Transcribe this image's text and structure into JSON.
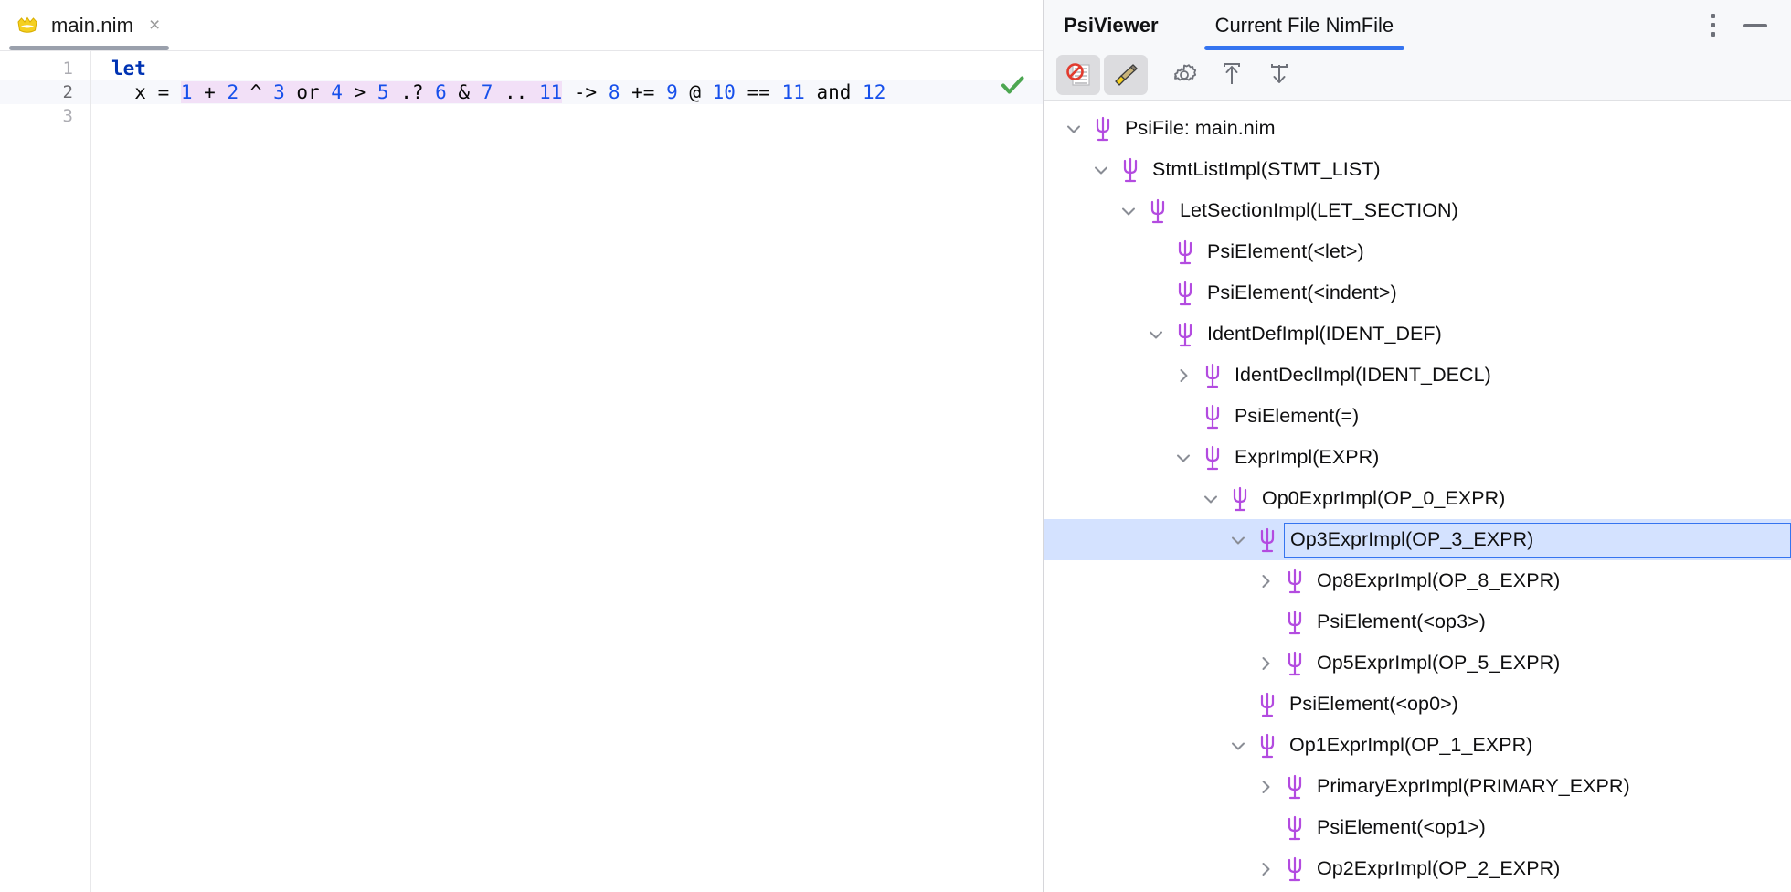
{
  "editor": {
    "tab": {
      "label": "main.nim",
      "icon": "nim-crown-icon",
      "close_label": "×"
    },
    "status_icon": "green-checkmark-icon",
    "lines": [
      {
        "number": "1",
        "current": false,
        "tokens": [
          {
            "text": "let",
            "kind": "kw",
            "highlight": false
          }
        ]
      },
      {
        "number": "2",
        "current": true,
        "tokens": [
          {
            "text": "  x ",
            "kind": "op",
            "highlight": false
          },
          {
            "text": "= ",
            "kind": "op",
            "highlight": false
          },
          {
            "text": "1",
            "kind": "num",
            "highlight": true
          },
          {
            "text": " + ",
            "kind": "op",
            "highlight": true
          },
          {
            "text": "2",
            "kind": "num",
            "highlight": true
          },
          {
            "text": " ^ ",
            "kind": "op",
            "highlight": true
          },
          {
            "text": "3",
            "kind": "num",
            "highlight": true
          },
          {
            "text": " or ",
            "kind": "op",
            "highlight": true
          },
          {
            "text": "4",
            "kind": "num",
            "highlight": true
          },
          {
            "text": " > ",
            "kind": "op",
            "highlight": true
          },
          {
            "text": "5",
            "kind": "num",
            "highlight": true
          },
          {
            "text": " .? ",
            "kind": "op",
            "highlight": true
          },
          {
            "text": "6",
            "kind": "num",
            "highlight": true
          },
          {
            "text": " & ",
            "kind": "op",
            "highlight": true
          },
          {
            "text": "7",
            "kind": "num",
            "highlight": true
          },
          {
            "text": " .. ",
            "kind": "op",
            "highlight": true
          },
          {
            "text": "11",
            "kind": "num",
            "highlight": true
          },
          {
            "text": " -> ",
            "kind": "op",
            "highlight": false
          },
          {
            "text": "8",
            "kind": "num",
            "highlight": false
          },
          {
            "text": " += ",
            "kind": "op",
            "highlight": false
          },
          {
            "text": "9",
            "kind": "num",
            "highlight": false
          },
          {
            "text": " @ ",
            "kind": "op",
            "highlight": false
          },
          {
            "text": "10",
            "kind": "num",
            "highlight": false
          },
          {
            "text": " == ",
            "kind": "op",
            "highlight": false
          },
          {
            "text": "11",
            "kind": "num",
            "highlight": false
          },
          {
            "text": " and ",
            "kind": "op",
            "highlight": false
          },
          {
            "text": "12",
            "kind": "num",
            "highlight": false
          }
        ]
      },
      {
        "number": "3",
        "current": false,
        "tokens": []
      }
    ]
  },
  "psi_panel": {
    "title": "PsiViewer",
    "tab_label": "Current File NimFile",
    "tab_accent": "#3574f0",
    "options_icon": "kebab-menu-icon",
    "minimize_icon": "minimize-icon",
    "toolbar": [
      {
        "name": "block-list-icon",
        "label": "",
        "active": true
      },
      {
        "name": "highlighter-brush-icon",
        "label": "",
        "active": true
      },
      {
        "name": "gear-icon",
        "label": "",
        "active": false
      },
      {
        "name": "export-up-icon",
        "label": "",
        "active": false
      },
      {
        "name": "import-down-icon",
        "label": "",
        "active": false
      }
    ],
    "tree": [
      {
        "label": "PsiFile: main.nim",
        "depth": 0,
        "twisty": "down",
        "selected": false
      },
      {
        "label": "StmtListImpl(STMT_LIST)",
        "depth": 1,
        "twisty": "down",
        "selected": false
      },
      {
        "label": "LetSectionImpl(LET_SECTION)",
        "depth": 2,
        "twisty": "down",
        "selected": false
      },
      {
        "label": "PsiElement(<let>)",
        "depth": 3,
        "twisty": "none",
        "selected": false
      },
      {
        "label": "PsiElement(<indent>)",
        "depth": 3,
        "twisty": "none",
        "selected": false
      },
      {
        "label": "IdentDefImpl(IDENT_DEF)",
        "depth": 3,
        "twisty": "down",
        "selected": false
      },
      {
        "label": "IdentDeclImpl(IDENT_DECL)",
        "depth": 4,
        "twisty": "right",
        "selected": false
      },
      {
        "label": "PsiElement(=)",
        "depth": 4,
        "twisty": "none",
        "selected": false
      },
      {
        "label": "ExprImpl(EXPR)",
        "depth": 4,
        "twisty": "down",
        "selected": false
      },
      {
        "label": "Op0ExprImpl(OP_0_EXPR)",
        "depth": 5,
        "twisty": "down",
        "selected": false
      },
      {
        "label": "Op3ExprImpl(OP_3_EXPR)",
        "depth": 6,
        "twisty": "down",
        "selected": true
      },
      {
        "label": "Op8ExprImpl(OP_8_EXPR)",
        "depth": 7,
        "twisty": "right",
        "selected": false
      },
      {
        "label": "PsiElement(<op3>)",
        "depth": 7,
        "twisty": "none",
        "selected": false
      },
      {
        "label": "Op5ExprImpl(OP_5_EXPR)",
        "depth": 7,
        "twisty": "right",
        "selected": false
      },
      {
        "label": "PsiElement(<op0>)",
        "depth": 6,
        "twisty": "none",
        "selected": false
      },
      {
        "label": "Op1ExprImpl(OP_1_EXPR)",
        "depth": 6,
        "twisty": "down",
        "selected": false
      },
      {
        "label": "PrimaryExprImpl(PRIMARY_EXPR)",
        "depth": 7,
        "twisty": "right",
        "selected": false
      },
      {
        "label": "PsiElement(<op1>)",
        "depth": 7,
        "twisty": "none",
        "selected": false
      },
      {
        "label": "Op2ExprImpl(OP_2_EXPR)",
        "depth": 7,
        "twisty": "right",
        "selected": false
      }
    ]
  }
}
